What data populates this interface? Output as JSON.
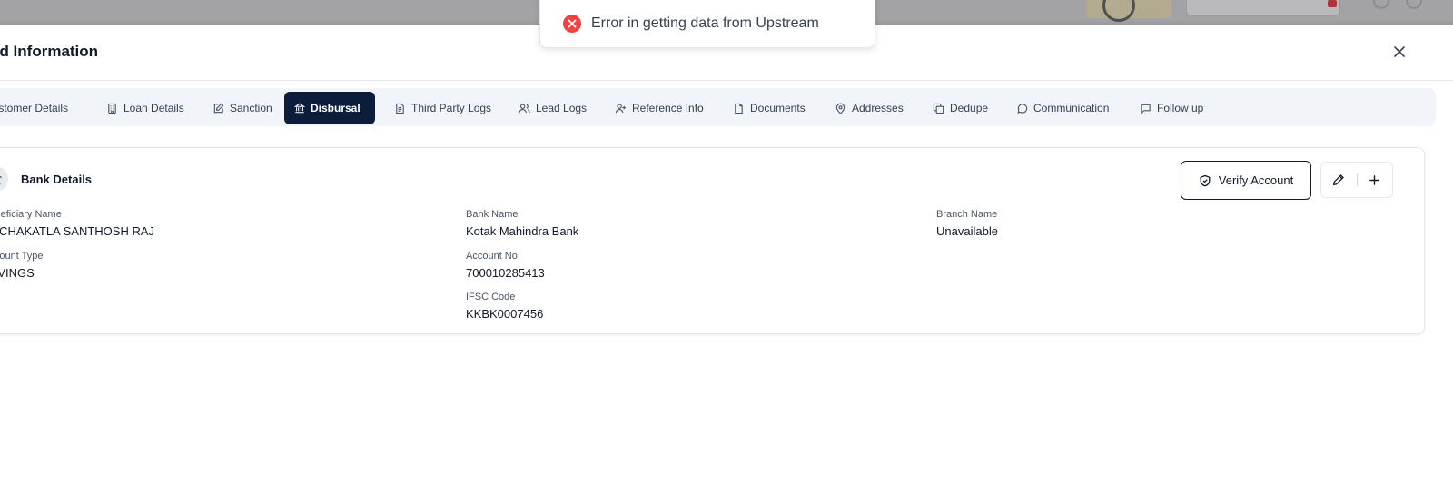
{
  "modal": {
    "title": "ad Information",
    "close_label": "close"
  },
  "toast": {
    "message": "Error in getting data from Upstream",
    "status_color": "#ef4444"
  },
  "tabs": [
    {
      "label": "Customer Details",
      "icon": "user-icon",
      "active": false
    },
    {
      "label": "Loan Details",
      "icon": "building-icon",
      "active": false
    },
    {
      "label": "Sanction",
      "icon": "edit-icon",
      "active": false
    },
    {
      "label": "Disbursal",
      "icon": "bank-icon",
      "active": true
    },
    {
      "label": "Third Party Logs",
      "icon": "file-text-icon",
      "active": false
    },
    {
      "label": "Lead Logs",
      "icon": "users-icon",
      "active": false
    },
    {
      "label": "Reference Info",
      "icon": "user-plus-icon",
      "active": false
    },
    {
      "label": "Documents",
      "icon": "file-icon",
      "active": false
    },
    {
      "label": "Addresses",
      "icon": "map-pin-icon",
      "active": false
    },
    {
      "label": "Dedupe",
      "icon": "copy-icon",
      "active": false
    },
    {
      "label": "Communication",
      "icon": "message-circle-icon",
      "active": false
    },
    {
      "label": "Follow up",
      "icon": "message-square-icon",
      "active": false
    }
  ],
  "bank_details": {
    "title": "Bank Details",
    "verify_label": "Verify Account",
    "fields": {
      "beneficiary_name": {
        "label": "Beneficiary Name",
        "value": "RACHAKATLA SANTHOSH RAJ"
      },
      "bank_name": {
        "label": "Bank Name",
        "value": "Kotak Mahindra Bank"
      },
      "branch_name": {
        "label": "Branch Name",
        "value": "Unavailable"
      },
      "account_type": {
        "label": "Account Type",
        "value": "SAVINGS"
      },
      "account_no": {
        "label": "Account No",
        "value": "700010285413"
      },
      "ifsc_code": {
        "label": "IFSC Code",
        "value": "KKBK0007456"
      }
    }
  },
  "colors": {
    "active_tab": "#0b1d3a",
    "tab_bar": "#f1f5f9",
    "backdrop": "#a3a3a6"
  }
}
